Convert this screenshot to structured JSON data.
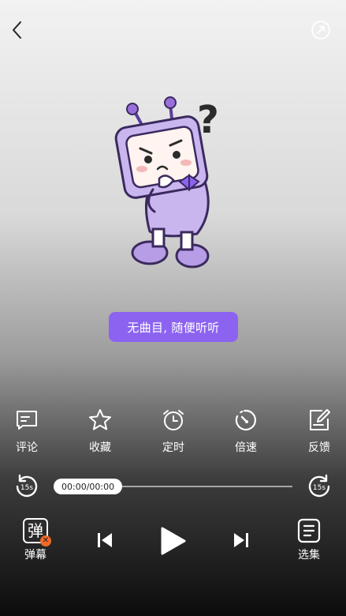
{
  "header": {
    "back_icon": "chevron-left-icon",
    "share_icon": "share-icon"
  },
  "player": {
    "empty_message": "无曲目, 随便听听",
    "current_time": "00:00/00:00",
    "accent_color": "#8c63f0"
  },
  "actions": [
    {
      "name": "comment",
      "icon": "comment-icon",
      "label": "评论"
    },
    {
      "name": "favorite",
      "icon": "star-icon",
      "label": "收藏"
    },
    {
      "name": "timer",
      "icon": "alarm-clock-icon",
      "label": "定时"
    },
    {
      "name": "speed",
      "icon": "speedometer-icon",
      "label": "倍速"
    },
    {
      "name": "feedback",
      "icon": "edit-icon",
      "label": "反馈"
    }
  ],
  "skip": {
    "back_label": "15s",
    "forward_label": "15s"
  },
  "controls": {
    "danmaku_glyph": "弹",
    "danmaku_label": "弹幕",
    "episodes_label": "选集"
  }
}
